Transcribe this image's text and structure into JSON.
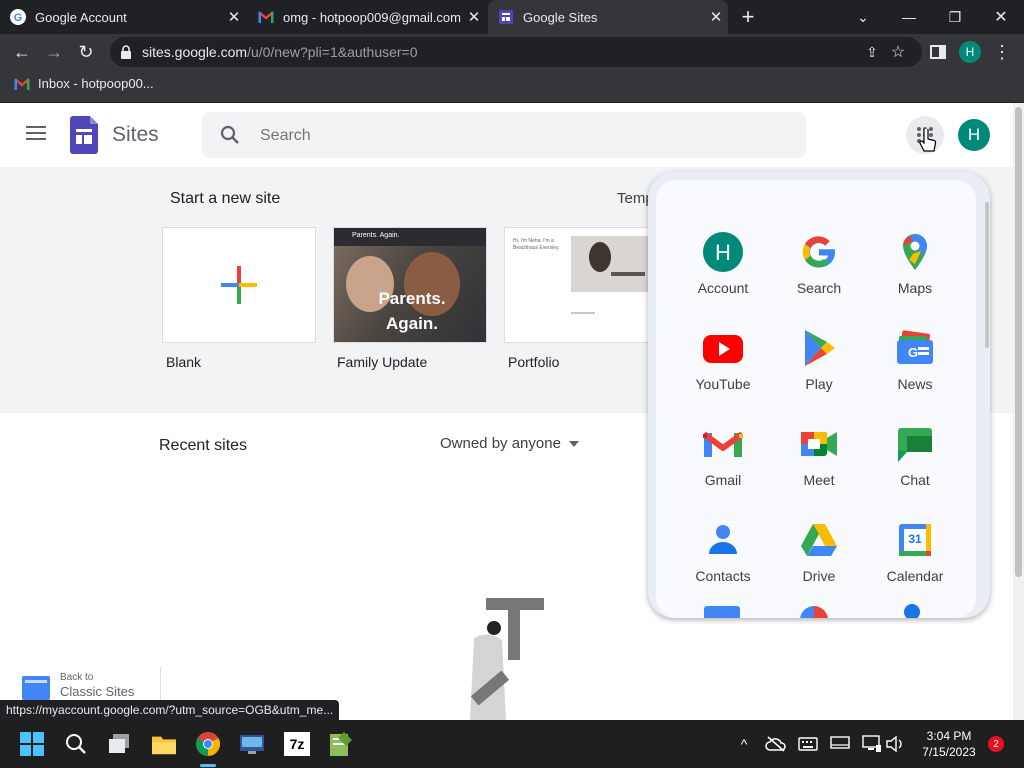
{
  "browser": {
    "tabs": [
      {
        "title": "Google Account",
        "active": false
      },
      {
        "title": "omg - hotpoop009@gmail.com -",
        "active": false
      },
      {
        "title": "Google Sites",
        "active": true
      }
    ],
    "url_host": "sites.google.com",
    "url_path": "/u/0/new?pli=1&authuser=0",
    "profile_initial": "H",
    "bookmark": "Inbox - hotpoop00...",
    "status_url": "https://myaccount.google.com/?utm_source=OGB&utm_me..."
  },
  "sites": {
    "title": "Sites",
    "search_placeholder": "Search",
    "avatar_initial": "H",
    "start_label": "Start a new site",
    "templates_label": "Temp",
    "templates": [
      {
        "label": "Blank"
      },
      {
        "label": "Family Update",
        "overlay_title": "Parents. Again.",
        "banner": "Parents. Again."
      },
      {
        "label": "Portfolio",
        "thumb_text": "Hi, I'm Neha. I'm a Beachhaus Eversley."
      }
    ],
    "recent_label": "Recent sites",
    "owned_label": "Owned by anyone",
    "classic_line1": "Back to",
    "classic_line2": "Classic Sites"
  },
  "apps": [
    {
      "label": "Account",
      "icon": "account-icon"
    },
    {
      "label": "Search",
      "icon": "google-search-icon"
    },
    {
      "label": "Maps",
      "icon": "maps-icon"
    },
    {
      "label": "YouTube",
      "icon": "youtube-icon"
    },
    {
      "label": "Play",
      "icon": "play-icon"
    },
    {
      "label": "News",
      "icon": "news-icon"
    },
    {
      "label": "Gmail",
      "icon": "gmail-icon"
    },
    {
      "label": "Meet",
      "icon": "meet-icon"
    },
    {
      "label": "Chat",
      "icon": "chat-icon"
    },
    {
      "label": "Contacts",
      "icon": "contacts-icon"
    },
    {
      "label": "Drive",
      "icon": "drive-icon"
    },
    {
      "label": "Calendar",
      "icon": "calendar-icon",
      "badge": "31"
    }
  ],
  "taskbar": {
    "time": "3:04 PM",
    "date": "7/15/2023",
    "notifications": "2",
    "sevenzip_label": "7z"
  },
  "colors": {
    "chrome_dark": "#202124",
    "chrome_mid": "#35363a",
    "accent_teal": "#00897b",
    "sites_purple": "#4f46b8"
  }
}
